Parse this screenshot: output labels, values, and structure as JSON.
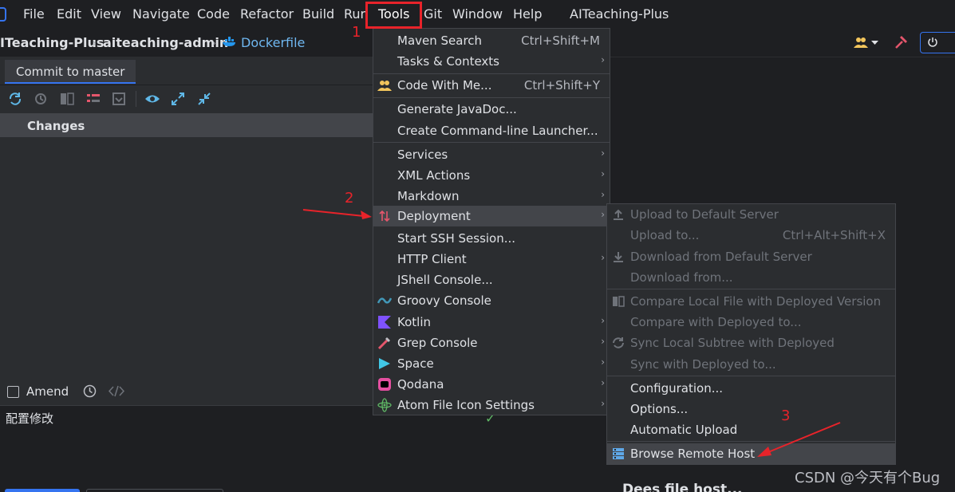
{
  "menubar": {
    "items": [
      "File",
      "Edit",
      "View",
      "Navigate",
      "Code",
      "Refactor",
      "Build",
      "Run",
      "Tools",
      "Git",
      "Window",
      "Help"
    ],
    "window_title": "AITeaching-Plus"
  },
  "navbar": {
    "project": "ITeaching-Plus",
    "module": "aiteaching-admin",
    "file": "Dockerfile",
    "separator": "›"
  },
  "commit_panel": {
    "tab_label": "Commit to master",
    "changes_label": "Changes",
    "amend_label": "Amend",
    "message": "配置修改",
    "check": "✓"
  },
  "tools_menu": {
    "items": [
      {
        "label": "Maven Search",
        "shortcut": "Ctrl+Shift+M",
        "submenu": false
      },
      {
        "label": "Tasks & Contexts",
        "shortcut": "",
        "submenu": true
      },
      {
        "label": "Code With Me...",
        "shortcut": "Ctrl+Shift+Y",
        "submenu": false,
        "icon": "users-icon"
      },
      {
        "label": "Generate JavaDoc...",
        "shortcut": "",
        "submenu": false
      },
      {
        "label": "Create Command-line Launcher...",
        "shortcut": "",
        "submenu": false
      },
      {
        "label": "Services",
        "shortcut": "",
        "submenu": true
      },
      {
        "label": "XML Actions",
        "shortcut": "",
        "submenu": true
      },
      {
        "label": "Markdown",
        "shortcut": "",
        "submenu": true
      },
      {
        "label": "Deployment",
        "shortcut": "",
        "submenu": true,
        "icon": "deployment-icon"
      },
      {
        "label": "Start SSH Session...",
        "shortcut": "",
        "submenu": false
      },
      {
        "label": "HTTP Client",
        "shortcut": "",
        "submenu": true
      },
      {
        "label": "JShell Console...",
        "shortcut": "",
        "submenu": false
      },
      {
        "label": "Groovy Console",
        "shortcut": "",
        "submenu": false,
        "icon": "groovy-icon"
      },
      {
        "label": "Kotlin",
        "shortcut": "",
        "submenu": true,
        "icon": "kotlin-icon"
      },
      {
        "label": "Grep Console",
        "shortcut": "",
        "submenu": true,
        "icon": "grep-console-icon"
      },
      {
        "label": "Space",
        "shortcut": "",
        "submenu": true,
        "icon": "space-icon"
      },
      {
        "label": "Qodana",
        "shortcut": "",
        "submenu": true,
        "icon": "qodana-icon"
      },
      {
        "label": "Atom File Icon Settings",
        "shortcut": "",
        "submenu": true,
        "icon": "atom-icon"
      }
    ]
  },
  "deployment_menu": {
    "items": [
      {
        "label": "Upload to Default Server",
        "shortcut": "",
        "enabled": false
      },
      {
        "label": "Upload to...",
        "shortcut": "Ctrl+Alt+Shift+X",
        "enabled": false
      },
      {
        "label": "Download from Default Server",
        "shortcut": "",
        "enabled": false
      },
      {
        "label": "Download from...",
        "shortcut": "",
        "enabled": false
      },
      {
        "label": "Compare Local File with Deployed Version",
        "shortcut": "",
        "enabled": false
      },
      {
        "label": "Compare with Deployed to...",
        "shortcut": "",
        "enabled": false
      },
      {
        "label": "Sync Local Subtree with Deployed",
        "shortcut": "",
        "enabled": false
      },
      {
        "label": "Sync with Deployed to...",
        "shortcut": "",
        "enabled": false
      },
      {
        "label": "Configuration...",
        "shortcut": "",
        "enabled": true
      },
      {
        "label": "Options...",
        "shortcut": "",
        "enabled": true
      },
      {
        "label": "Automatic Upload",
        "shortcut": "",
        "enabled": true
      },
      {
        "label": "Browse Remote Host",
        "shortcut": "",
        "enabled": true
      }
    ]
  },
  "annotations": {
    "step1": "1",
    "step2": "2",
    "step3": "3",
    "color": "#e8232a"
  },
  "editor": {
    "fragment": "Dees file host..."
  },
  "watermark": "CSDN @今天有个Bug",
  "colors": {
    "accent": "#3574f0",
    "background": "#1e1f22",
    "panel": "#2b2d30",
    "selection": "#43454a"
  }
}
